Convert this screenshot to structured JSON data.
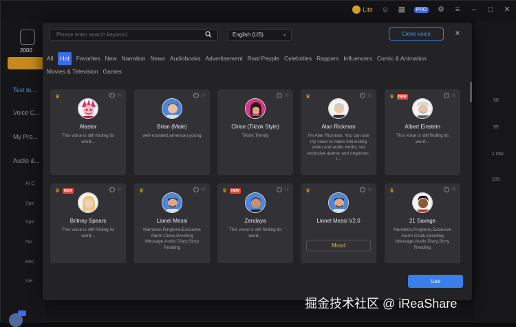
{
  "titlebar": {
    "coins": "Lite"
  },
  "sidebar": {
    "count": "2000",
    "items": [
      {
        "label": "Text to..."
      },
      {
        "label": "Voice C..."
      },
      {
        "label": "My Pro..."
      },
      {
        "label": "Audio &..."
      }
    ],
    "subitems": [
      "AI C",
      "Spe",
      "Spe",
      "No",
      "Rec",
      "Vie"
    ]
  },
  "right_panel": {
    "values": [
      "50",
      "95",
      "1.00x",
      "100"
    ]
  },
  "modal": {
    "search_placeholder": "Please enter search keyword",
    "language": "English (US)",
    "clone_label": "Clone voice",
    "close_label": "×",
    "tabs": [
      {
        "label": "All",
        "active": false
      },
      {
        "label": "Hot",
        "active": true
      },
      {
        "label": "Favorites",
        "active": false
      },
      {
        "label": "New",
        "active": false
      },
      {
        "label": "Narration",
        "active": false
      },
      {
        "label": "News",
        "active": false
      },
      {
        "label": "Audiobooks",
        "active": false
      },
      {
        "label": "Advertisement",
        "active": false
      },
      {
        "label": "Real People",
        "active": false
      },
      {
        "label": "Celebrities",
        "active": false
      },
      {
        "label": "Rappers",
        "active": false
      },
      {
        "label": "Influencers",
        "active": false
      },
      {
        "label": "Comic & Animation",
        "active": false
      },
      {
        "label": "Movies & Television",
        "active": false
      },
      {
        "label": "Games",
        "active": false
      }
    ],
    "cards": [
      {
        "name": "Alastor",
        "desc": "This voice is still finding its word...",
        "new": false,
        "crown": true,
        "avatar": "alastor"
      },
      {
        "name": "Brian (Male)",
        "desc": "well-rounded,american,young",
        "new": false,
        "crown": false,
        "avatar": "man"
      },
      {
        "name": "Chloe (Tiktok Style)",
        "desc": "Tiktok,Trendy",
        "new": false,
        "crown": false,
        "avatar": "woman-dark"
      },
      {
        "name": "Alan Rickman",
        "desc": "I'm Alan Rickman. You can use my voice to make interesting video and audio works, set exclusive alarms and ringtones, r...",
        "new": false,
        "crown": true,
        "avatar": "old-man"
      },
      {
        "name": "Albert Einstein",
        "desc": "This voice is still finding its word...",
        "new": true,
        "crown": true,
        "avatar": "einstein"
      },
      {
        "name": "Britney Spears",
        "desc": "This voice is still finding its word...",
        "new": true,
        "crown": true,
        "avatar": "blonde"
      },
      {
        "name": "Lionel Messi",
        "desc": "Narration,Ringtone,Exclusive Alarm Clock,Greeting Message,Audio Diary,Story Reading",
        "new": false,
        "crown": true,
        "avatar": "messi"
      },
      {
        "name": "Zendaya",
        "desc": "This voice is still finding its word...",
        "new": true,
        "crown": true,
        "avatar": "zendaya"
      },
      {
        "name": "Lionel Messi V2.0",
        "desc": "",
        "mood": "Mood",
        "new": false,
        "crown": true,
        "avatar": "messi"
      },
      {
        "name": "21 Savage",
        "desc": "Narration,Ringtone,Exclusive Alarm Clock,Greeting Message,Audio Diary,Story Reading",
        "new": false,
        "crown": true,
        "avatar": "savage"
      }
    ],
    "new_badge": "NEW",
    "use_label": "Use"
  },
  "watermark": "掘金技术社区 @ iReaShare",
  "colors": {
    "accent": "#3a7ee8",
    "crown": "#e2a615",
    "new_badge": "#e8453c"
  }
}
